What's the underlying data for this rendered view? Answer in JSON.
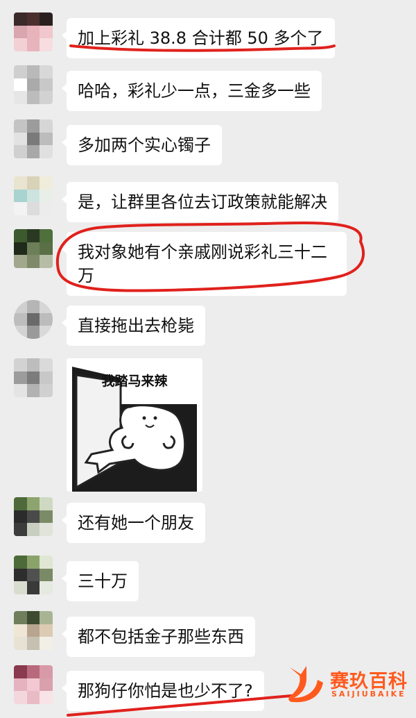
{
  "messages": [
    {
      "text": "加上彩礼 38.8 合计都 50 多个了"
    },
    {
      "text": "哈哈，彩礼少一点，三金多一些"
    },
    {
      "text": "多加两个实心镯子"
    },
    {
      "text": "是，让群里各位去订政策就能解决"
    },
    {
      "text": "我对象她有个亲戚刚说彩礼三十二万"
    },
    {
      "text": "直接拖出去枪毙"
    },
    {
      "sticker_caption": "我踏马来辣"
    },
    {
      "text": "还有她一个朋友"
    },
    {
      "text": "三十万"
    },
    {
      "text": "都不包括金子那些东西"
    },
    {
      "text": "那狗仔你怕是也少不了?"
    }
  ],
  "watermark": {
    "cn": "赛玖百科",
    "en": "SAIJIUBAIKE"
  },
  "colors": {
    "background": "#ededed",
    "bubble": "#ffffff",
    "annotation": "#e0211c",
    "watermark": "#ff5a1e"
  },
  "icons": [
    "sticker-cat-image",
    "watermark-whale-icon"
  ]
}
